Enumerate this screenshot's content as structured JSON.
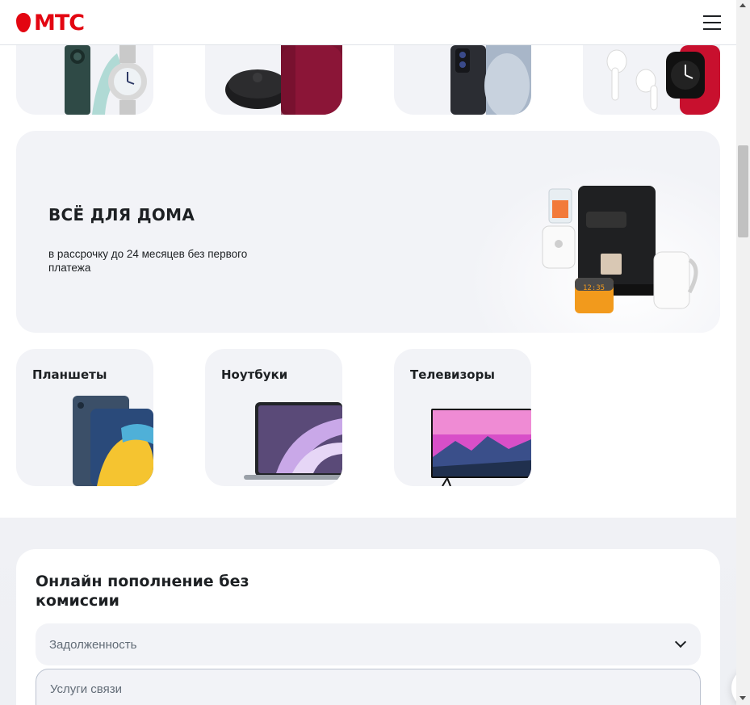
{
  "header": {
    "logo_text": "МТС",
    "brand_color": "#e30611",
    "menu_icon": "burger-menu-icon"
  },
  "top_tiles": [
    {
      "icon": "smartphone-and-watch-image"
    },
    {
      "icon": "robot-vacuum-and-speaker-image"
    },
    {
      "icon": "smartphone-image"
    },
    {
      "icon": "earbuds-and-smartwatch-image"
    }
  ],
  "banner": {
    "title": "ВСЁ ДЛЯ ДОМА",
    "subtitle": "в рассрочку до 24 месяцев без первого платежа",
    "image": "home-appliances-image"
  },
  "categories": [
    {
      "label": "Планшеты",
      "icon": "tablet-image"
    },
    {
      "label": "Ноутбуки",
      "icon": "laptop-image"
    },
    {
      "label": "Телевизоры",
      "icon": "tv-image"
    }
  ],
  "payment": {
    "title": "Онлайн пополнение без комиссии",
    "select_value": "Задолженность",
    "service_value": "Услуги связи"
  },
  "colors": {
    "tile_bg": "#f2f3f7",
    "text": "#1d2023",
    "muted": "#626c77"
  }
}
